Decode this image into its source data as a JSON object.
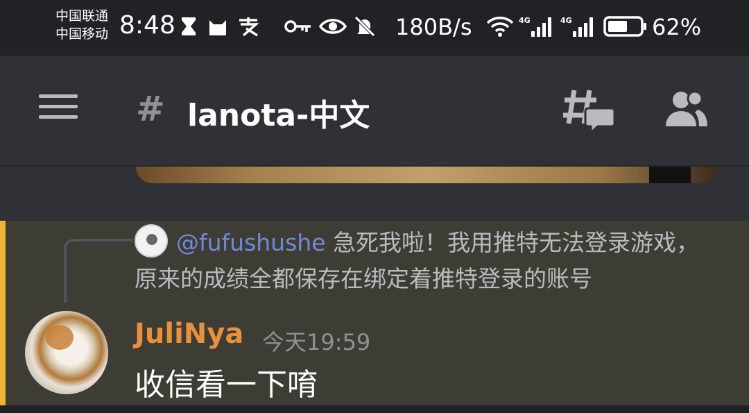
{
  "status_bar": {
    "carrier_1": "中国联通",
    "carrier_2": "中国移动",
    "time": "8:48",
    "net_speed": "180B/s",
    "battery_percent": "62%",
    "battery_level": 0.62,
    "icons": [
      "hourglass-icon",
      "cat-app-icon",
      "alipay-icon",
      "key-icon",
      "eye-icon",
      "bell-off-icon",
      "wifi-icon",
      "4g-signal-icon",
      "4g-signal-icon",
      "battery-icon"
    ]
  },
  "header": {
    "hash_symbol": "#",
    "channel_name": "lanota-中文"
  },
  "message": {
    "reply": {
      "mention": "@fufushushe",
      "text": "急死我啦！我用推特无法登录游戏，原来的成绩全都保存在绑定着推特登录的账号"
    },
    "username": "JuliNya",
    "timestamp": "今天19:59",
    "body": "收信看一下唷"
  },
  "colors": {
    "background": "#303136",
    "status_bar": "#202225",
    "highlight": "#3e3d35",
    "highlight_border": "#f0b232",
    "username": "#e9913a",
    "mention": "#7289da"
  }
}
